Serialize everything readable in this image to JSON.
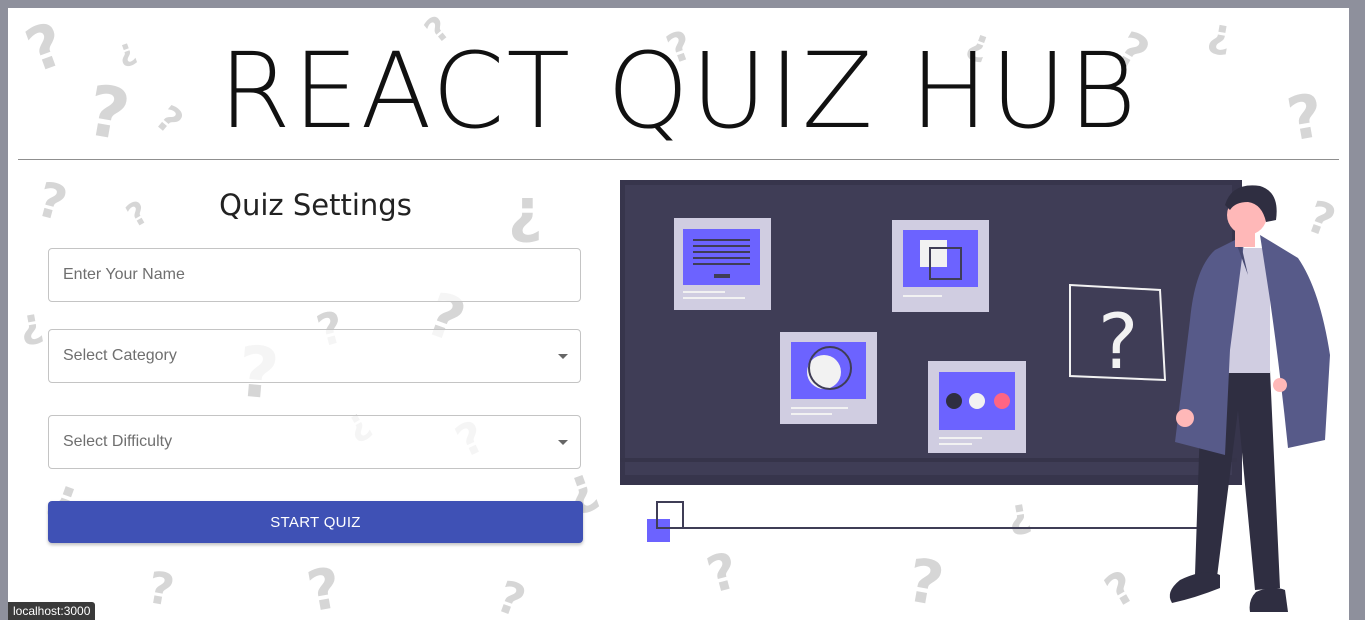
{
  "header": {
    "title": "REACT QUIZ HUB"
  },
  "settings": {
    "title": "Quiz Settings",
    "name_placeholder": "Enter Your Name",
    "category_label": "Select Category",
    "difficulty_label": "Select Difficulty",
    "start_label": "START QUIZ"
  },
  "illustration": {
    "board_question_mark": "?"
  },
  "status_bar": {
    "url": "localhost:3000"
  },
  "colors": {
    "accent": "#3f51b5",
    "board": "#3f3d56",
    "highlight": "#6c63ff",
    "frame": "#8e909c"
  }
}
